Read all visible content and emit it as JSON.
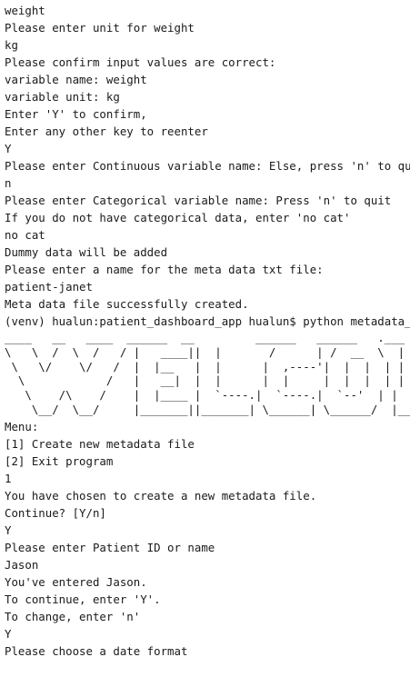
{
  "terminal": {
    "lines_before": [
      "weight",
      "Please enter unit for weight",
      "kg",
      "Please confirm input values are correct:",
      "variable name: weight",
      "variable unit: kg",
      "Enter 'Y' to confirm,",
      "Enter any other key to reenter",
      "Y",
      "Please enter Continuous variable name: Else, press 'n' to quit",
      "n",
      "Please enter Categorical variable name: Press 'n' to quit",
      "If you do not have categorical data, enter 'no cat'",
      "no cat",
      "Dummy data will be added",
      "Please enter a name for the meta data txt file:",
      "patient-janet",
      "Meta data file successfully created.",
      "(venv) hualun:patient_dashboard_app hualun$ python metadata_file.py"
    ],
    "banner": [
      "____   __   ____  ______  __         ______   ______   .___  ___",
      "\\   \\  /  \\  /   / |   ____||  |       /      | /  __  \\  |   \\/   |",
      " \\   \\/    \\/   /  |  |__   |  |      |  ,----'|  |  |  | |  \\  /  |",
      "  \\            /   |   __|  |  |      |  |     |  |  |  | |  |\\/|  |",
      "   \\    /\\    /    |  |____ |  `----.|  `----.|  `--'  | |  |  |  |",
      "    \\__/  \\__/     |_______||_______| \\______| \\______/  |__|  |__|"
    ],
    "lines_after": [
      "Menu:",
      "[1] Create new metadata file",
      "[2] Exit program",
      "1",
      "You have chosen to create a new metadata file.",
      "Continue? [Y/n]",
      "Y",
      "Please enter Patient ID or name",
      "Jason",
      "You've entered Jason.",
      "To continue, enter 'Y'.",
      "To change, enter 'n'",
      "Y",
      "Please choose a date format"
    ]
  }
}
